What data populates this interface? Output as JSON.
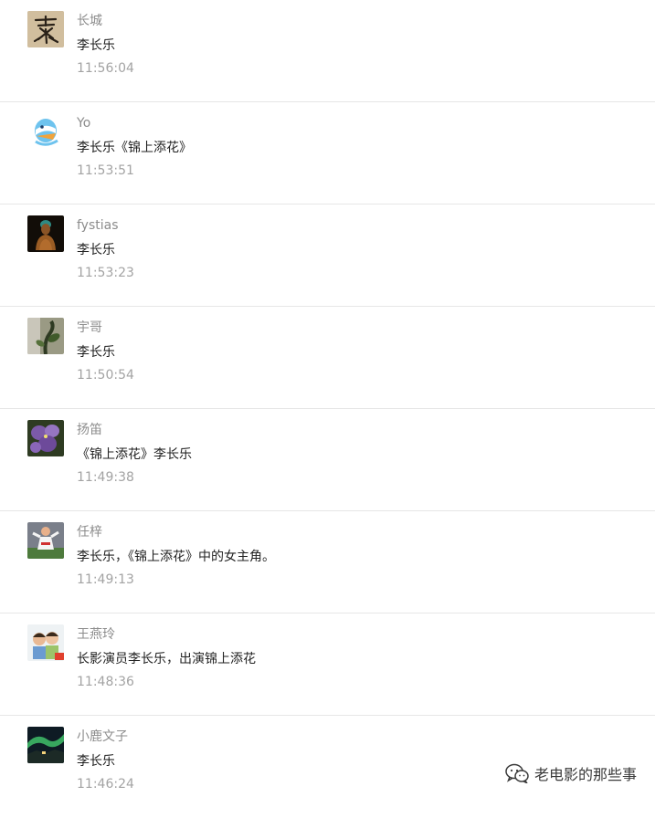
{
  "comments": [
    {
      "nickname": "长城",
      "content": "李长乐",
      "time": "11:56:04",
      "avatar": "calligraphy-avatar"
    },
    {
      "nickname": "Yo",
      "content": "李长乐《锦上添花》",
      "time": "11:53:51",
      "avatar": "cartoon-avatar"
    },
    {
      "nickname": "fystias",
      "content": "李长乐",
      "time": "11:53:23",
      "avatar": "buddha-avatar"
    },
    {
      "nickname": "宇哥",
      "content": "李长乐",
      "time": "11:50:54",
      "avatar": "plant-avatar"
    },
    {
      "nickname": "扬笛",
      "content": "《锦上添花》李长乐",
      "time": "11:49:38",
      "avatar": "flower-avatar"
    },
    {
      "nickname": "任梓",
      "content": "李长乐，《锦上添花》中的女主角。",
      "time": "11:49:13",
      "avatar": "football-avatar"
    },
    {
      "nickname": "王燕玲",
      "content": "长影演员李长乐，出演锦上添花",
      "time": "11:48:36",
      "avatar": "children-avatar"
    },
    {
      "nickname": "小鹿文子",
      "content": "李长乐",
      "time": "11:46:24",
      "avatar": "aurora-avatar"
    }
  ],
  "watermark": {
    "text": "老电影的那些事",
    "icon": "wechat-icon"
  }
}
